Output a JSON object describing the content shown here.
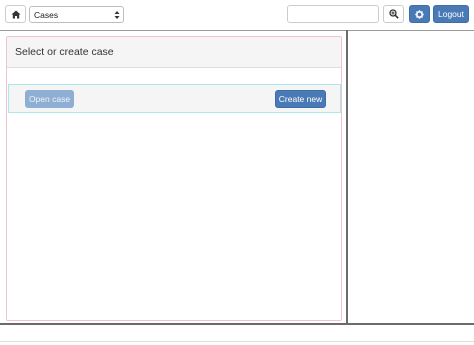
{
  "toolbar": {
    "home_icon": "home-icon",
    "case_select_value": "Cases",
    "search_placeholder": "",
    "zoom_icon": "zoom-in-icon",
    "gear_icon": "gear-icon",
    "logout_label": "Logout"
  },
  "panel": {
    "heading": "Select or create case",
    "open_case_label": "Open case",
    "create_new_label": "Create new"
  },
  "colors": {
    "primary": "#4a7ab5",
    "primary_disabled": "#8eaed4",
    "panel_border": "#f0c4c9",
    "row_border": "#aee6ef"
  }
}
